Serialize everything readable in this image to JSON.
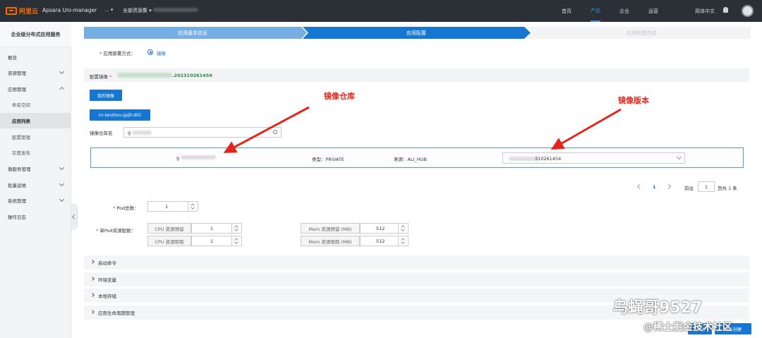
{
  "topbar": {
    "brand": "阿里云",
    "product": "Apsara Uni-manager",
    "region": "...",
    "resource_set": "全部资源集",
    "nav": [
      "首页",
      "产品",
      "企业",
      "运营"
    ],
    "active_nav": "产品",
    "lang": "简体中文"
  },
  "sidebar": {
    "title": "企业级分布式应用服务",
    "items": [
      {
        "label": "概览"
      },
      {
        "label": "资源管理"
      },
      {
        "label": "应用管理"
      },
      {
        "label": "命名空间"
      },
      {
        "label": "应用列表"
      },
      {
        "label": "配置管理"
      },
      {
        "label": "灰度发布"
      },
      {
        "label": "微服务管理"
      },
      {
        "label": "批量运维"
      },
      {
        "label": "系统管理"
      },
      {
        "label": "操作日志"
      }
    ]
  },
  "steps": [
    "应用基本信息",
    "应用配置",
    "应用创建完成"
  ],
  "deploy": {
    "label": "应用部署方式：",
    "option": "镜像"
  },
  "image": {
    "label": "配置镜像",
    "value_suffix": ".202310261454"
  },
  "my_image_button": "我的镜像",
  "namespace_tag": "cn-lanzhou-gsjlt-d01",
  "repo_search": {
    "label": "镜像仓库名",
    "value": "g"
  },
  "repo_row": {
    "name": "g",
    "type": "类型：PRIVATE",
    "source": "来源：ALI_HUB",
    "version": "310261454"
  },
  "pagination": {
    "current": "1",
    "goto_label": "前往",
    "page": "1",
    "total": "页共 1 条"
  },
  "pod": {
    "label": "Pod总数：",
    "value": "1"
  },
  "resources": {
    "label": "单Pod资源配额：",
    "cpu_request": "CPU 资源预留",
    "cpu_request_value": "1",
    "cpu_limit": "CPU 资源限制",
    "cpu_limit_value": "1",
    "mem_request": "Mem 资源预留 (MB)",
    "mem_request_value": "512",
    "mem_limit": "Mem 资源限制 (MB)",
    "mem_limit_value": "512"
  },
  "sections": [
    "启动命令",
    "环境变量",
    "本地存储",
    "应用生命周期管理"
  ],
  "footer": {
    "prev": "上一步",
    "create": "确认创建"
  },
  "annotations": {
    "repo": "镜像仓库",
    "version": "镜像版本"
  },
  "watermark": {
    "main": "乌蝇哥9527",
    "sub": "@稀土掘金技术社区"
  },
  "colors": {
    "primary": "#1677d2",
    "accent": "#ff6a00",
    "annotation": "#e4251c",
    "topbar": "#2b2f36"
  }
}
